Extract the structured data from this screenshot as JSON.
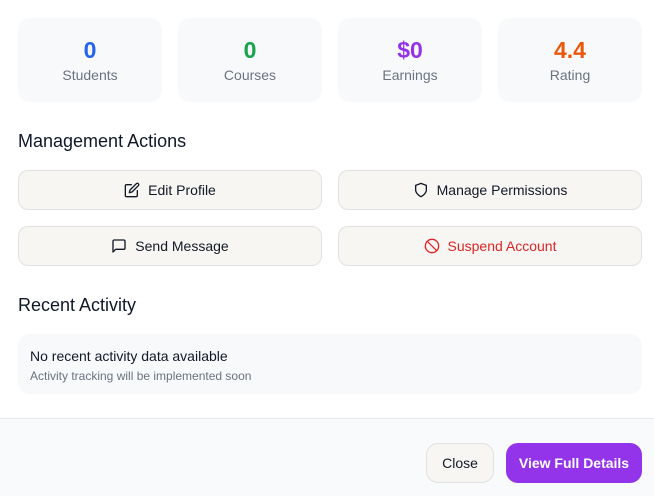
{
  "stats": [
    {
      "value": "0",
      "label": "Students",
      "color": "#2563eb"
    },
    {
      "value": "0",
      "label": "Courses",
      "color": "#16a34a"
    },
    {
      "value": "$0",
      "label": "Earnings",
      "color": "#9333ea"
    },
    {
      "value": "4.4",
      "label": "Rating",
      "color": "#ea580c"
    }
  ],
  "management": {
    "title": "Management Actions",
    "edit_profile": {
      "label": "Edit Profile",
      "icon": "edit-icon"
    },
    "manage_permissions": {
      "label": "Manage Permissions",
      "icon": "shield-icon"
    },
    "send_message": {
      "label": "Send Message",
      "icon": "message-icon"
    },
    "suspend_account": {
      "label": "Suspend Account",
      "icon": "ban-icon",
      "color": "#dc2626"
    }
  },
  "activity": {
    "title": "Recent Activity",
    "empty_message": "No recent activity data available",
    "empty_subtext": "Activity tracking will be implemented soon"
  },
  "footer": {
    "close_label": "Close",
    "details_label": "View Full Details",
    "accent_color": "#9333ea"
  }
}
